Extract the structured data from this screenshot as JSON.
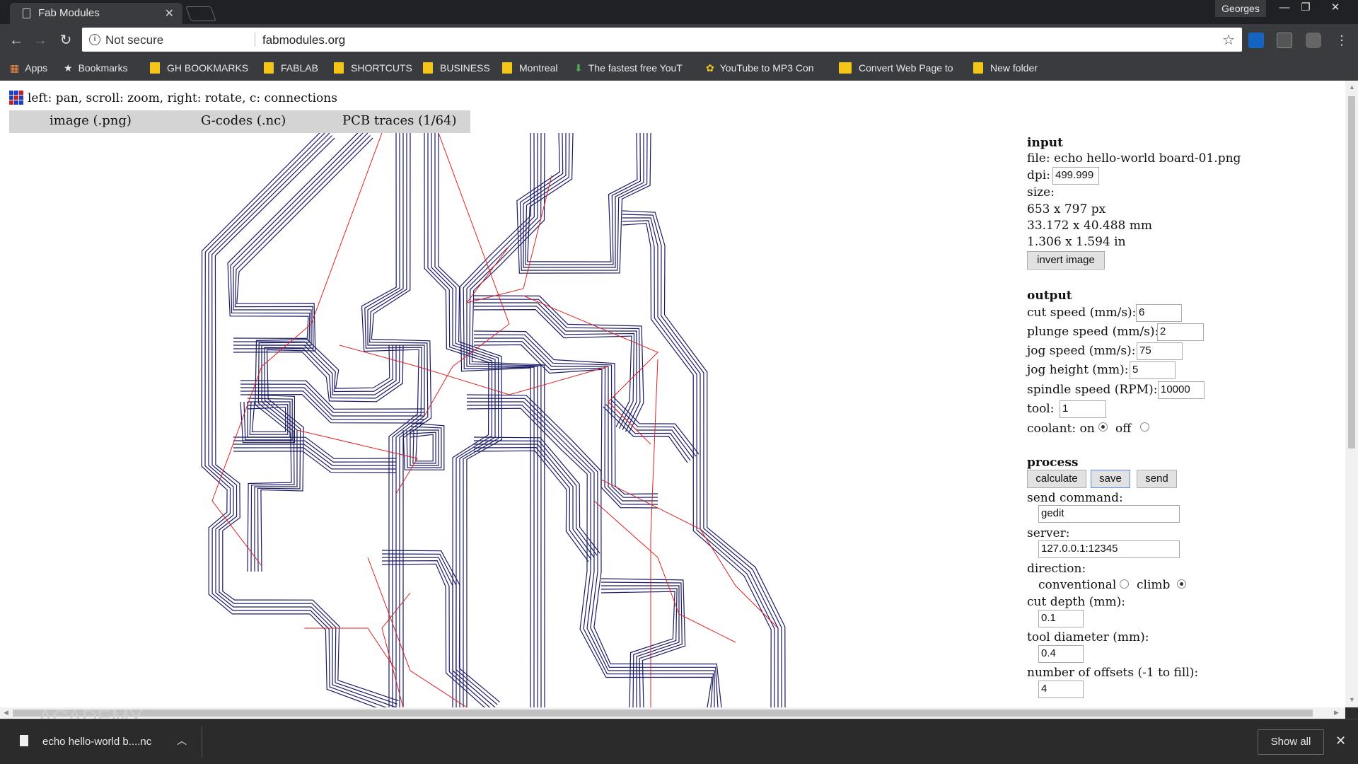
{
  "browser": {
    "tab_title": "Fab Modules",
    "profile": "Georges",
    "address": {
      "security": "Not secure",
      "url": "fabmodules.org"
    },
    "bookmarks": [
      {
        "label": "Apps",
        "icon": "apps-grid-icon"
      },
      {
        "label": "Bookmarks",
        "icon": "star-icon"
      },
      {
        "label": "GH BOOKMARKS",
        "icon": "folder-icon"
      },
      {
        "label": "FABLAB",
        "icon": "folder-icon"
      },
      {
        "label": "SHORTCUTS",
        "icon": "folder-icon"
      },
      {
        "label": "BUSINESS",
        "icon": "folder-icon"
      },
      {
        "label": "Montreal",
        "icon": "folder-icon"
      },
      {
        "label": "The fastest free YouT",
        "icon": "download-arrow-icon"
      },
      {
        "label": "YouTube to MP3 Con",
        "icon": "mp3-converter-icon"
      },
      {
        "label": "Convert Web Page to",
        "icon": "folder-open-icon"
      },
      {
        "label": "New folder",
        "icon": "folder-icon"
      }
    ]
  },
  "app": {
    "hint": "left: pan, scroll: zoom, right: rotate, c: connections",
    "menu": [
      "image (.png)",
      "G-codes (.nc)",
      "PCB traces (1/64)"
    ],
    "input": {
      "heading": "input",
      "file_label": "file:",
      "file_value": "echo hello-world board-01.png",
      "dpi_label": "dpi:",
      "dpi_value": "499.999",
      "size_label": "size:",
      "size_px": "653 x 797 px",
      "size_mm": "33.172 x 40.488 mm",
      "size_in": "1.306 x 1.594 in",
      "invert_button": "invert image"
    },
    "output": {
      "heading": "output",
      "cut_speed_label": "cut speed (mm/s):",
      "cut_speed": "6",
      "plunge_speed_label": "plunge speed (mm/s):",
      "plunge_speed": "2",
      "jog_speed_label": "jog speed (mm/s):",
      "jog_speed": "75",
      "jog_height_label": "jog height (mm):",
      "jog_height": "5",
      "spindle_label": "spindle speed (RPM):",
      "spindle": "10000",
      "tool_label": "tool:",
      "tool": "1",
      "coolant_label": "coolant: on",
      "coolant_off_label": "off",
      "coolant_selected": "on"
    },
    "process": {
      "heading": "process",
      "calculate": "calculate",
      "save": "save",
      "send": "send",
      "send_command_label": "send command:",
      "send_command": "gedit",
      "server_label": "server:",
      "server": "127.0.0.1:12345",
      "direction_label": "direction:",
      "conventional_label": "conventional",
      "climb_label": "climb",
      "direction_selected": "climb",
      "cut_depth_label": "cut depth (mm):",
      "cut_depth": "0.1",
      "tool_diameter_label": "tool diameter (mm):",
      "tool_diameter": "0.4",
      "offsets_label": "number of offsets (-1 to fill):",
      "offsets": "4"
    },
    "watermark": "ACADEMY"
  },
  "downloads": {
    "file": "echo hello-world b....nc",
    "show_all": "Show all"
  },
  "colors": {
    "toolpath": "#1a1a66",
    "connection": "#e02020"
  }
}
